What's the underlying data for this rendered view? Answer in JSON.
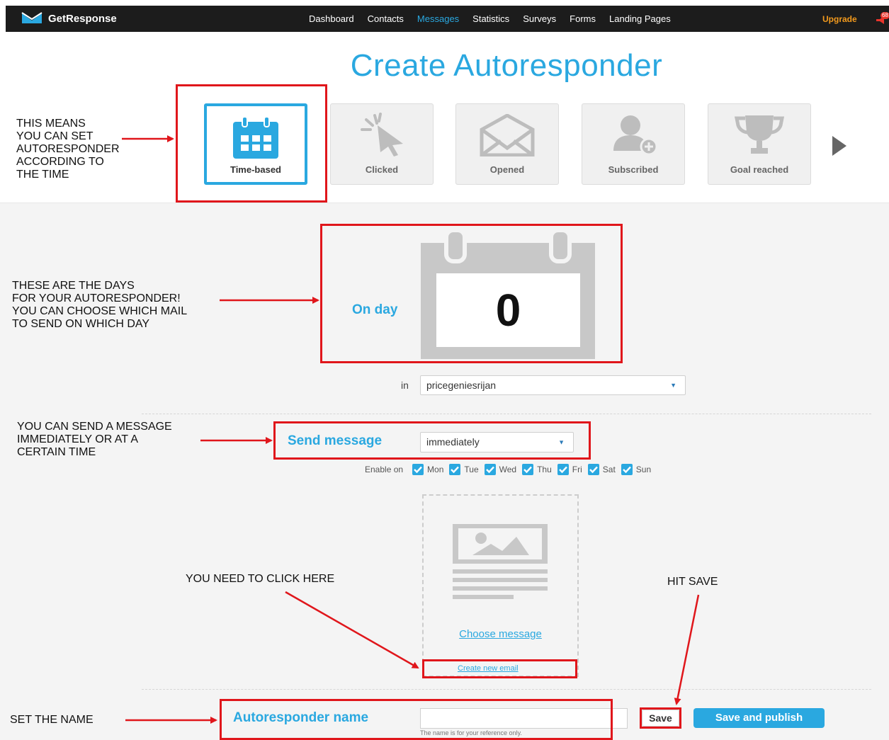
{
  "header": {
    "brand": "GetResponse",
    "nav": [
      "Dashboard",
      "Contacts",
      "Messages",
      "Statistics",
      "Surveys",
      "Forms",
      "Landing Pages"
    ],
    "active_nav": "Messages",
    "upgrade_label": "Upgrade",
    "notification_count": "68"
  },
  "page_title": "Create Autoresponder",
  "tiles": [
    {
      "label": "Time-based",
      "icon": "calendar-icon",
      "active": true
    },
    {
      "label": "Clicked",
      "icon": "cursor-click-icon"
    },
    {
      "label": "Opened",
      "icon": "open-envelope-icon"
    },
    {
      "label": "Subscribed",
      "icon": "user-plus-icon"
    },
    {
      "label": "Goal reached",
      "icon": "trophy-icon"
    }
  ],
  "schedule": {
    "on_day_label": "On day",
    "day_value": "0",
    "in_label": "in",
    "campaign_selected": "pricegeniesrijan"
  },
  "send": {
    "label": "Send message",
    "timing_selected": "immediately",
    "enable_on_label": "Enable on",
    "days": [
      "Mon",
      "Tue",
      "Wed",
      "Thu",
      "Fri",
      "Sat",
      "Sun"
    ]
  },
  "message": {
    "choose_label": "Choose message",
    "create_label": "Create new email"
  },
  "name": {
    "label": "Autoresponder name",
    "value": "",
    "hint": "The name is for your reference only."
  },
  "actions": {
    "save_label": "Save",
    "publish_label": "Save and publish"
  },
  "annotations": {
    "time": "THIS MEANS\nYOU CAN SET\nAUTORESPONDER\nACCORDING TO\nTHE TIME",
    "days": "THESE ARE THE DAYS\nFOR YOUR AUTORESPONDER!\nYOU CAN CHOOSE WHICH MAIL\nTO SEND ON WHICH DAY",
    "send": "YOU CAN SEND A MESSAGE\nIMMEDIATELY OR AT A\nCERTAIN TIME",
    "click_here": "YOU NEED TO CLICK HERE",
    "hit_save": "HIT SAVE",
    "set_name": "SET THE NAME"
  },
  "colors": {
    "accent": "#2aa8e0",
    "annotation_red": "#e0161b",
    "upgrade": "#f39a1d",
    "topbar": "#1c1c1c"
  }
}
